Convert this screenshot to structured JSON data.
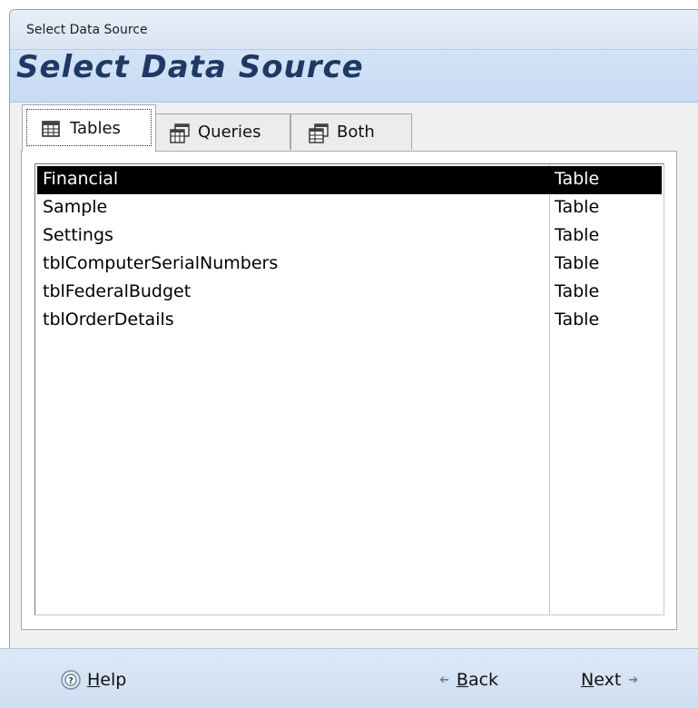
{
  "window": {
    "title": "Select Data Source"
  },
  "header": {
    "heading": "Select Data Source"
  },
  "tabs": [
    {
      "label": "Tables",
      "icon": "table-icon",
      "active": true
    },
    {
      "label": "Queries",
      "icon": "query-icon",
      "active": false
    },
    {
      "label": "Both",
      "icon": "both-icon",
      "active": false
    }
  ],
  "list": {
    "items": [
      {
        "name": "Financial",
        "type": "Table",
        "selected": true
      },
      {
        "name": "Sample",
        "type": "Table",
        "selected": false
      },
      {
        "name": "Settings",
        "type": "Table",
        "selected": false
      },
      {
        "name": "tblComputerSerialNumbers",
        "type": "Table",
        "selected": false
      },
      {
        "name": "tblFederalBudget",
        "type": "Table",
        "selected": false
      },
      {
        "name": "tblOrderDetails",
        "type": "Table",
        "selected": false
      }
    ]
  },
  "footer": {
    "help": {
      "accel": "H",
      "rest": "elp",
      "icon": "help-icon"
    },
    "back": {
      "accel": "B",
      "rest": "ack",
      "icon": "left-arrow-icon"
    },
    "next": {
      "accel": "N",
      "rest": "ext",
      "icon": "right-arrow-icon"
    }
  },
  "colors": {
    "heading": "#1f3864",
    "header_band": "#c7dbf4",
    "selection": "#000000"
  }
}
